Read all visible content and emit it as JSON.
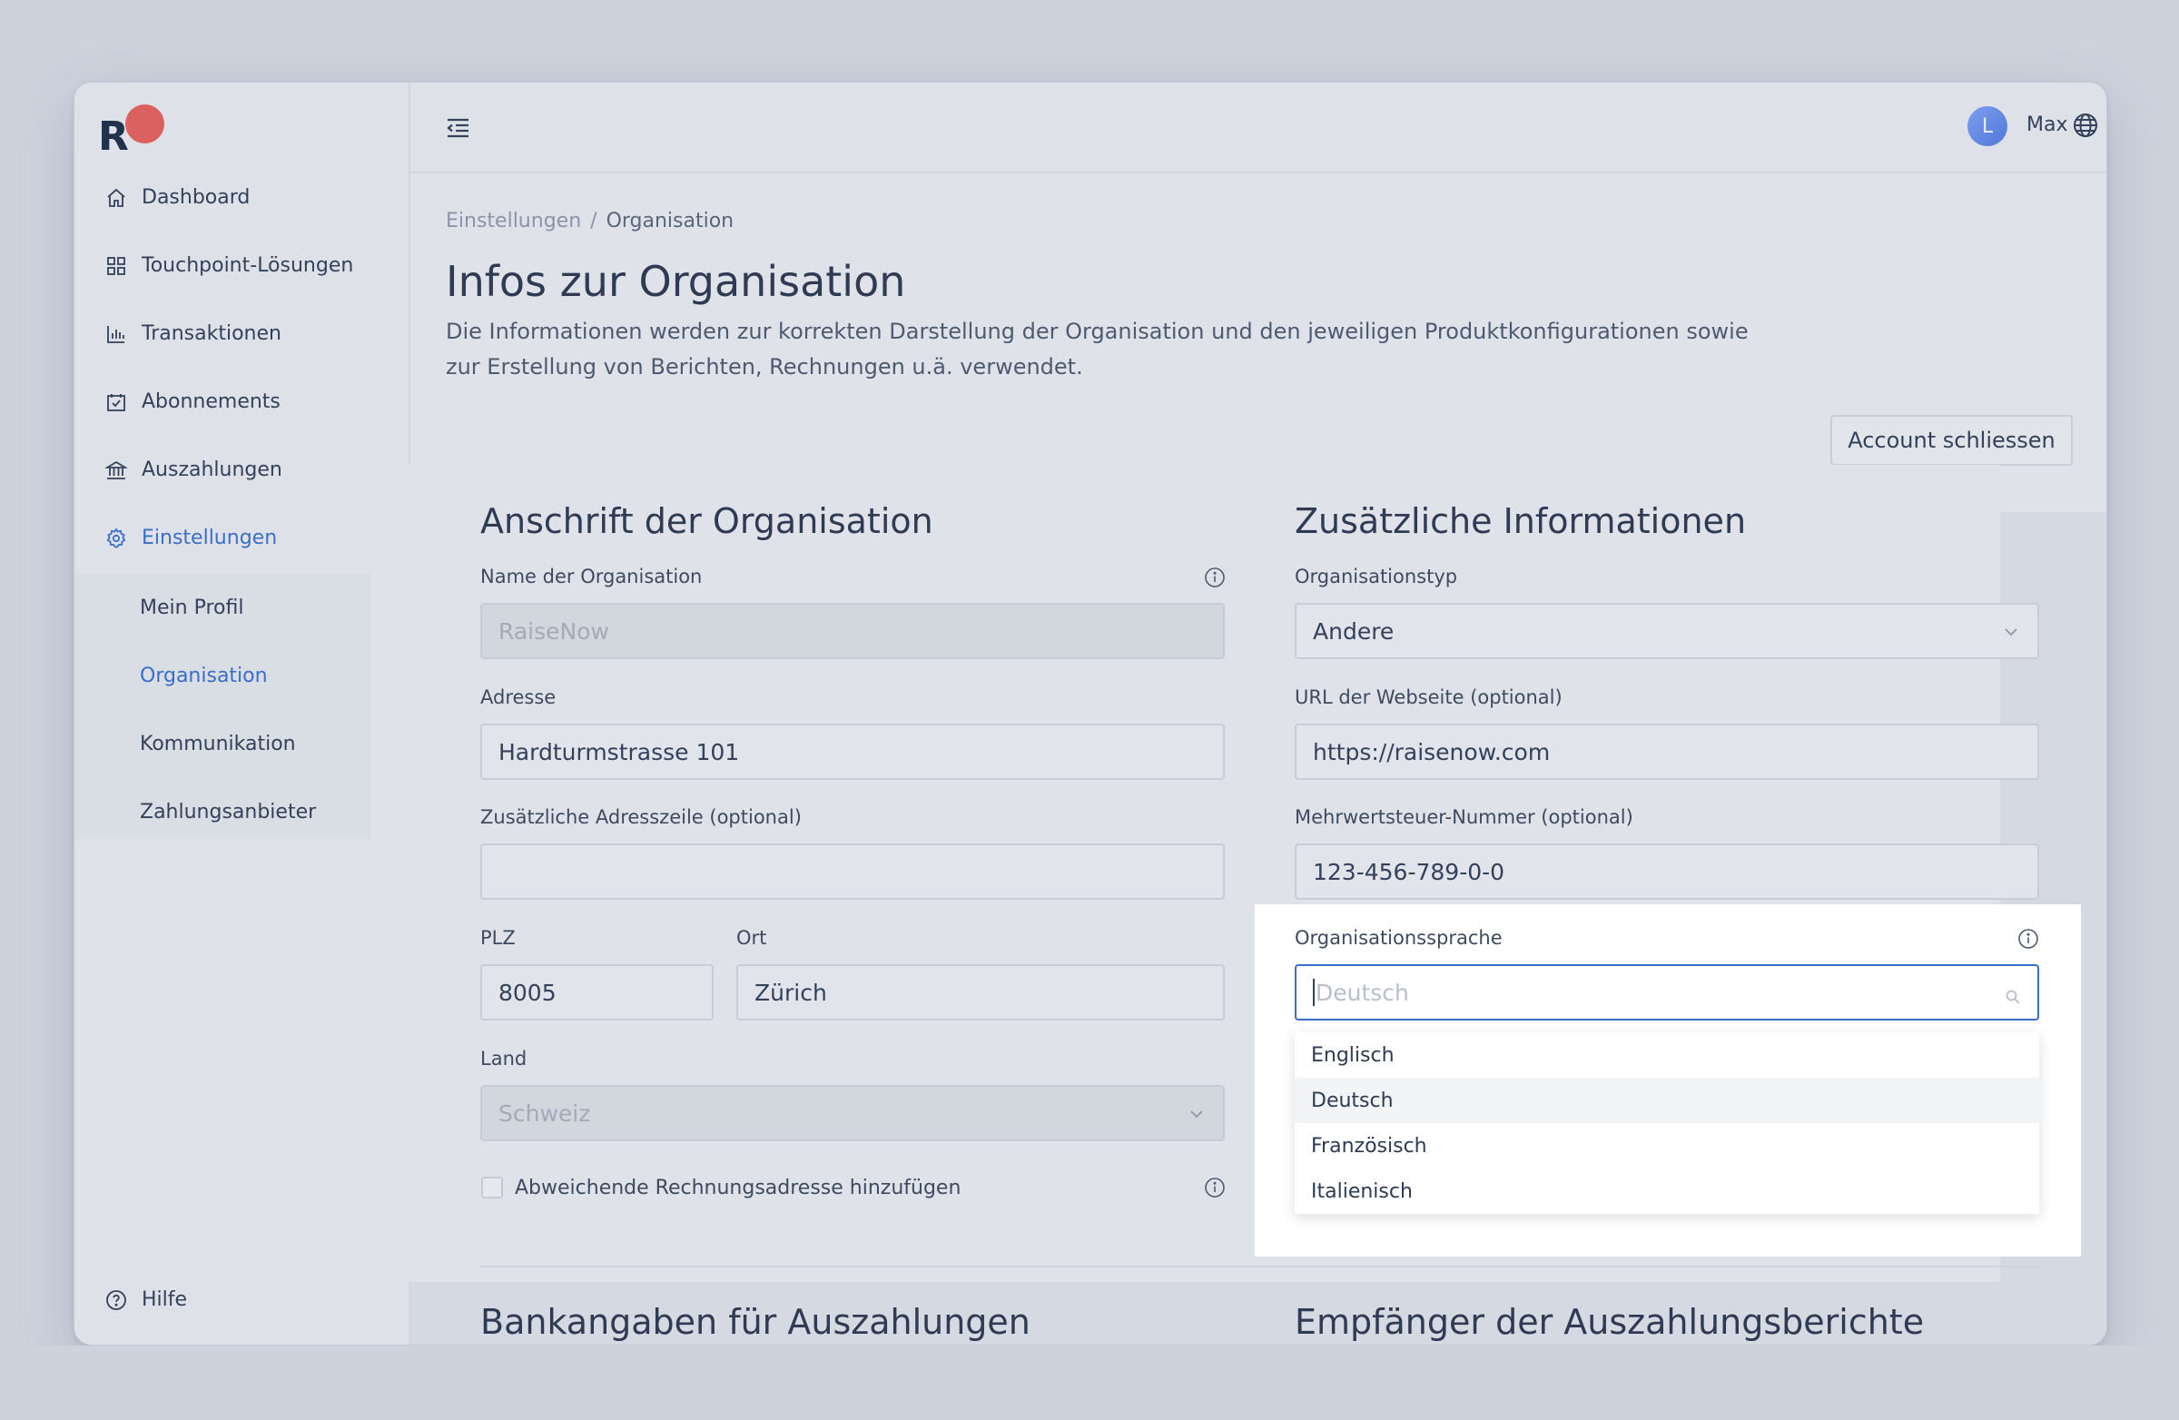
{
  "sidebar": {
    "logo_letter": "R",
    "items": [
      {
        "label": "Dashboard",
        "icon": "home-icon"
      },
      {
        "label": "Touchpoint-Lösungen",
        "icon": "grid-icon"
      },
      {
        "label": "Transaktionen",
        "icon": "bar-chart-icon"
      },
      {
        "label": "Abonnements",
        "icon": "calendar-check-icon"
      },
      {
        "label": "Auszahlungen",
        "icon": "bank-icon"
      },
      {
        "label": "Einstellungen",
        "icon": "gear-icon"
      }
    ],
    "submenu": [
      "Mein Profil",
      "Organisation",
      "Kommunikation",
      "Zahlungsanbieter"
    ],
    "help_label": "Hilfe",
    "accent_color": "#3b6dc9"
  },
  "topbar": {
    "avatar_initial": "L",
    "user_name": "Max"
  },
  "header": {
    "breadcrumb": [
      "Einstellungen",
      "/",
      "Organisation"
    ],
    "title": "Infos zur Organisation",
    "description": "Die Informationen werden zur korrekten Darstellung der Organisation und den jeweiligen Produktkonfigurationen sowie zur Erstellung von Berichten, Rechnungen u.ä. verwendet.",
    "close_account_button": "Account schliessen"
  },
  "address": {
    "section_title": "Anschrift der Organisation",
    "org_name_label": "Name der Organisation",
    "org_name_value": "RaiseNow",
    "address_label": "Adresse",
    "address_value": "Hardturmstrasse 101",
    "address2_label": "Zusätzliche Adresszeile (optional)",
    "address2_value": "",
    "zip_label": "PLZ",
    "zip_value": "8005",
    "city_label": "Ort",
    "city_value": "Zürich",
    "country_label": "Land",
    "country_value": "Schweiz",
    "billing_checkbox_label": "Abweichende Rechnungsadresse hinzufügen"
  },
  "additional": {
    "section_title": "Zusätzliche Informationen",
    "org_type_label": "Organisationstyp",
    "org_type_value": "Andere",
    "url_label": "URL der Webseite (optional)",
    "url_value": "https://raisenow.com",
    "vat_label": "Mehrwertsteuer-Nummer (optional)",
    "vat_value": "123-456-789-0-0",
    "language_label": "Organisationssprache",
    "language_placeholder": "Deutsch",
    "language_options": [
      "Englisch",
      "Deutsch",
      "Französisch",
      "Italienisch"
    ]
  },
  "lower_sections": {
    "bank_title": "Bankangaben für Auszahlungen",
    "recipients_title": "Empfänger der Auszahlungsberichte"
  }
}
